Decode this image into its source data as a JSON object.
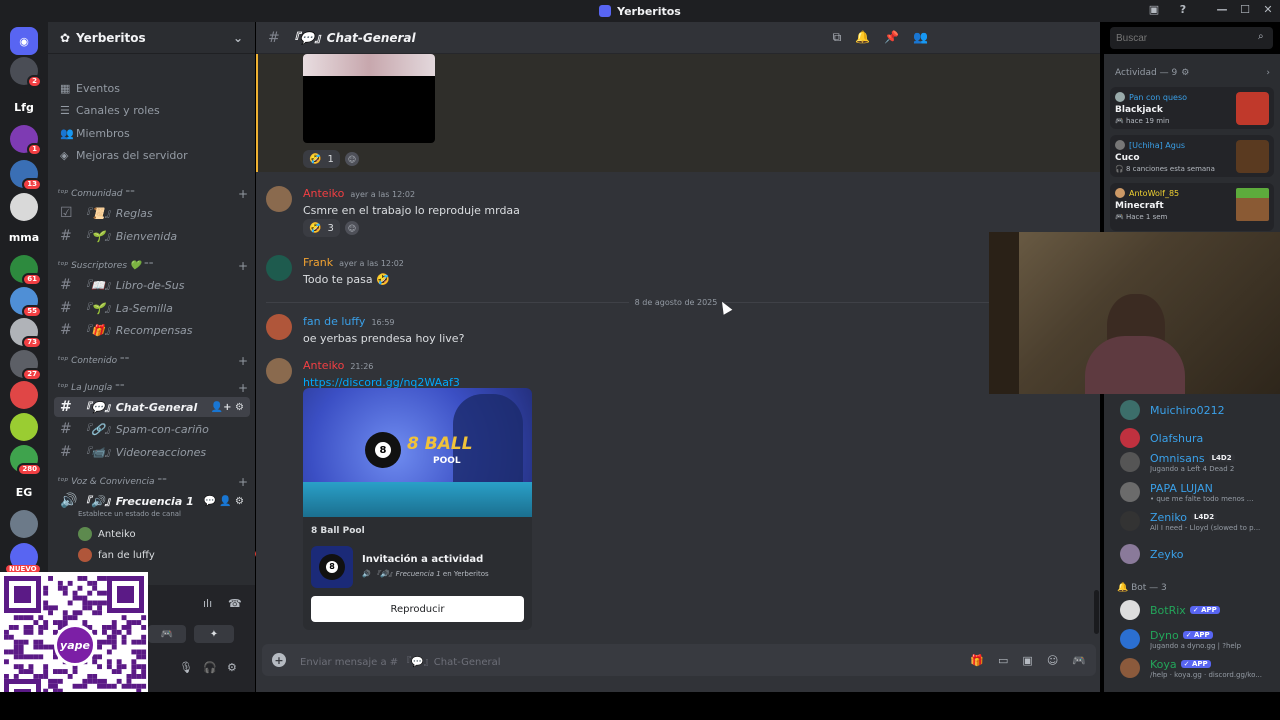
{
  "app": {
    "title": "Yerberitos"
  },
  "servers": [
    {
      "label": "",
      "color": "#5865f2",
      "badge": ""
    },
    {
      "label": "",
      "color": "#4a4d55",
      "badge": "2"
    },
    {
      "label": "Lfg",
      "color": "#1e1f22",
      "badge": ""
    },
    {
      "label": "",
      "color": "#7e3bb3",
      "badge": "1"
    },
    {
      "label": "",
      "color": "#3a6fb5",
      "badge": "13"
    },
    {
      "label": "",
      "color": "#d9d9d9",
      "badge": ""
    },
    {
      "label": "mma",
      "color": "#1e1f22",
      "badge": ""
    },
    {
      "label": "",
      "color": "#2d8a3e",
      "badge": "61"
    },
    {
      "label": "",
      "color": "#4f8fd6",
      "badge": "55"
    },
    {
      "label": "",
      "color": "#b0b3b8",
      "badge": "73"
    },
    {
      "label": "",
      "color": "#5c5f66",
      "badge": "27"
    },
    {
      "label": "",
      "color": "#e04646",
      "badge": ""
    },
    {
      "label": "",
      "color": "#9acd32",
      "badge": ""
    },
    {
      "label": "",
      "color": "#3fa34d",
      "badge": "280"
    },
    {
      "label": "EG",
      "color": "#1e1f22",
      "badge": ""
    },
    {
      "label": "",
      "color": "#6c7a89",
      "badge": ""
    },
    {
      "label": "",
      "color": "#5865f2",
      "badge": ""
    },
    {
      "label": "NUEVO",
      "color": "#1e1f22",
      "badge": ""
    }
  ],
  "guild": {
    "name": "Yerberitos"
  },
  "nav": [
    {
      "icon": "calendar-icon",
      "label": "Eventos"
    },
    {
      "icon": "list-icon",
      "label": "Canales y roles"
    },
    {
      "icon": "members-icon",
      "label": "Miembros"
    },
    {
      "icon": "boost-icon",
      "label": "Mejoras del servidor"
    }
  ],
  "categories": [
    {
      "label": "ᵗᵒᵖ Comunidad ⁼⁼",
      "channels": [
        "『📜』Reglas",
        "『🌱』Bienvenida"
      ]
    },
    {
      "label": "ᵗᵒᵖ Suscriptores 💚 ⁼⁼",
      "channels": [
        "『📖』Libro-de-Sus",
        "『🌱』La-Semilla",
        "『🎁』Recompensas"
      ]
    },
    {
      "label": "ᵗᵒᵖ Contenido ⁼⁼",
      "channels": []
    },
    {
      "label": "ᵗᵒᵖ La Jungla ⁼⁼",
      "channels": [
        "『💬』Chat-General",
        "『🔗』Spam-con-cariño",
        "『📹』Videoreacciones"
      ]
    },
    {
      "label": "ᵗᵒᵖ Voz & Convivencia ⁼⁼",
      "channels": []
    }
  ],
  "voice": {
    "channel": "『🔊』Frecuencia 1",
    "status": "Establece un estado de canal",
    "users": [
      "Anteiko",
      "fan de luffy"
    ]
  },
  "header": {
    "channel": "『💬』Chat-General"
  },
  "search": {
    "placeholder": "Buscar"
  },
  "messages": [
    {
      "reactions": [
        {
          "emoji": "🤣",
          "count": "1"
        }
      ]
    },
    {
      "author": "Anteiko",
      "author_color": "#f23f43",
      "time": "ayer a las 12:02",
      "text": "Csmre en el trabajo lo reproduje mrdaa",
      "reactions": [
        {
          "emoji": "🤣",
          "count": "3"
        }
      ]
    },
    {
      "author": "Frank",
      "author_color": "#f0a232",
      "time": "ayer a las 12:02",
      "text": "Todo te pasa 🤣"
    },
    {
      "date_divider": "8 de agosto de 2025"
    },
    {
      "author": "fan de luffy",
      "author_color": "#3aa0e8",
      "time": "16:59",
      "text": "oe yerbas prendesa hoy live?"
    },
    {
      "author": "Anteiko",
      "author_color": "#f23f43",
      "time": "21:26",
      "link": "https://discord.gg/nq2WAaf3"
    }
  ],
  "invite": {
    "banner_title": "8 BALL",
    "banner_sub": "POOL",
    "game": "8 Ball Pool",
    "title": "Invitación a actividad",
    "channel": "『🔊』Frecuencia 1",
    "in_server": "en Yerberitos",
    "button": "Reproducir"
  },
  "composer": {
    "placeholder": "Enviar mensaje a # 『💬』Chat-General"
  },
  "activity": {
    "header": "Actividad — 9",
    "cards": [
      {
        "user": "Pan con queso",
        "user_color": "#3aa0e8",
        "game": "Blackjack",
        "detail": "hace 19 min"
      },
      {
        "user": "[Uchiha] Agus",
        "user_color": "#3aa0e8",
        "game": "Cuco",
        "detail": "8 canciones esta semana"
      },
      {
        "user": "AntoWolf_85",
        "user_color": "#f0d232",
        "game": "Minecraft",
        "detail": "Hace 1 sem"
      }
    ]
  },
  "members": [
    {
      "name": "Muichiro0212",
      "color": "#3aa0e8",
      "sub": "",
      "tag": ""
    },
    {
      "name": "Olafshura",
      "color": "#3aa0e8",
      "sub": "",
      "tag": ""
    },
    {
      "name": "Omnisans",
      "color": "#3aa0e8",
      "sub": "Jugando a Left 4 Dead 2",
      "tag": "L4D2"
    },
    {
      "name": "PAPA LUJAN",
      "color": "#3aa0e8",
      "sub": "• que me falte todo menos ...",
      "tag": ""
    },
    {
      "name": "Zeniko",
      "color": "#3aa0e8",
      "sub": "All I need - Lloyd (slowed to p...",
      "tag": "L4D2"
    },
    {
      "name": "Zeyko",
      "color": "#3aa0e8",
      "sub": "",
      "tag": ""
    }
  ],
  "bots": {
    "header": "Bot — 3",
    "items": [
      {
        "name": "BotRix",
        "tag": "APP",
        "sub": ""
      },
      {
        "name": "Dyno",
        "tag": "APP",
        "sub": "Jugando a dyno.gg | ?help"
      },
      {
        "name": "Koya",
        "tag": "APP",
        "sub": "/help · koya.gg · discord.gg/ko..."
      }
    ]
  },
  "qr": {
    "brand": "yape"
  }
}
